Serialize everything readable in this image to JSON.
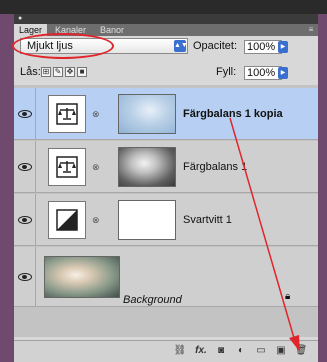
{
  "tabs": [
    {
      "label": "Lager",
      "active": true
    },
    {
      "label": "Kanaler",
      "active": false
    },
    {
      "label": "Banor",
      "active": false
    }
  ],
  "blend_mode": {
    "selected": "Mjukt ljus"
  },
  "opacity": {
    "label": "Opacitet:",
    "value": "100%"
  },
  "lock": {
    "label": "Lås:"
  },
  "fill": {
    "label": "Fyll:",
    "value": "100%"
  },
  "layers": [
    {
      "name": "Färgbalans 1 kopia",
      "type": "adjustment-color-balance",
      "selected": true,
      "visible": true
    },
    {
      "name": "Färgbalans 1",
      "type": "adjustment-color-balance",
      "selected": false,
      "visible": true
    },
    {
      "name": "Svartvitt 1",
      "type": "adjustment-black-white",
      "selected": false,
      "visible": true
    },
    {
      "name": "Background",
      "type": "background",
      "selected": false,
      "visible": true,
      "locked": true
    }
  ],
  "toolbar": {
    "icons": [
      "link-icon",
      "fx-icon",
      "mask-icon",
      "adjustment-icon",
      "group-icon",
      "new-layer-icon",
      "trash-icon"
    ],
    "fx_label": "fx."
  },
  "colors": {
    "selected_row": "#b6cff2",
    "annotation_red": "#e0262b",
    "select_accent": "#3a6fd0"
  }
}
